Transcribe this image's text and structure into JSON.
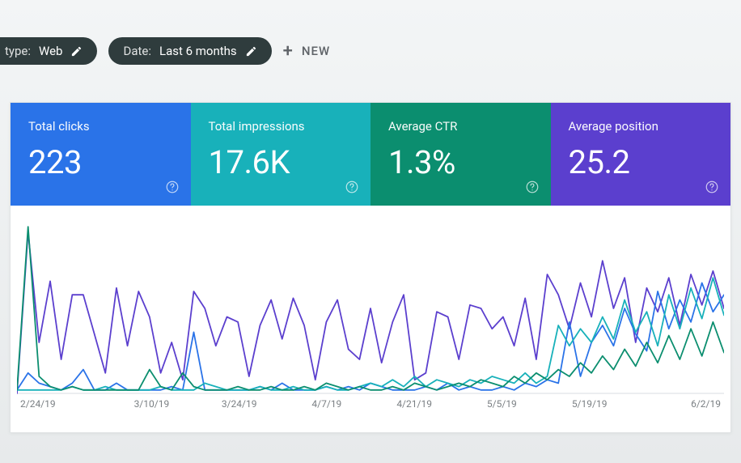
{
  "filters": {
    "search_type": {
      "label_key": "type:",
      "label_value": "Web"
    },
    "date": {
      "label_key": "Date:",
      "label_value": "Last 6 months"
    },
    "new_label": "NEW"
  },
  "metrics": {
    "clicks": {
      "label": "Total clicks",
      "value": "223",
      "help": "?"
    },
    "impressions": {
      "label": "Total impressions",
      "value": "17.6K",
      "help": "?"
    },
    "ctr": {
      "label": "Average CTR",
      "value": "1.3%",
      "help": "?"
    },
    "position": {
      "label": "Average position",
      "value": "25.2",
      "help": "?"
    }
  },
  "colors": {
    "clicks": "#2a73e8",
    "impressions": "#18b1ba",
    "ctr": "#0b8e6f",
    "position": "#5b3fce"
  },
  "chart_data": {
    "type": "line",
    "title": "",
    "xlabel": "",
    "ylabel": "",
    "x_ticks": [
      "2/24/19",
      "3/10/19",
      "3/24/19",
      "4/7/19",
      "4/21/19",
      "5/5/19",
      "5/19/19",
      "6/2/19"
    ],
    "ylim": [
      0,
      100
    ],
    "series": [
      {
        "name": "position",
        "color": "#5b3fce",
        "values": [
          0,
          95,
          30,
          66,
          20,
          58,
          58,
          35,
          12,
          62,
          28,
          60,
          45,
          12,
          30,
          8,
          60,
          50,
          28,
          45,
          42,
          10,
          40,
          55,
          32,
          56,
          40,
          8,
          42,
          55,
          26,
          20,
          50,
          18,
          42,
          58,
          8,
          12,
          48,
          45,
          20,
          52,
          50,
          38,
          45,
          28,
          56,
          20,
          70,
          58,
          38,
          65,
          45,
          78,
          50,
          68,
          30,
          62,
          48,
          68,
          40,
          70,
          52,
          72,
          50
        ]
      },
      {
        "name": "clicks",
        "color": "#2a73e8",
        "values": [
          2,
          12,
          6,
          4,
          2,
          6,
          14,
          2,
          2,
          6,
          2,
          2,
          2,
          2,
          4,
          2,
          36,
          2,
          2,
          2,
          2,
          2,
          4,
          2,
          6,
          2,
          2,
          2,
          4,
          2,
          4,
          2,
          6,
          4,
          2,
          2,
          2,
          4,
          2,
          6,
          2,
          4,
          2,
          2,
          4,
          2,
          6,
          4,
          8,
          6,
          42,
          10,
          30,
          40,
          28,
          50,
          35,
          25,
          60,
          38,
          55,
          42,
          65,
          48,
          58
        ]
      },
      {
        "name": "impressions",
        "color": "#18b1ba",
        "values": [
          2,
          2,
          2,
          2,
          2,
          4,
          2,
          2,
          4,
          2,
          2,
          2,
          2,
          4,
          2,
          2,
          2,
          6,
          4,
          2,
          2,
          2,
          4,
          2,
          2,
          4,
          2,
          2,
          4,
          2,
          2,
          4,
          6,
          4,
          8,
          4,
          10,
          4,
          8,
          6,
          4,
          8,
          6,
          10,
          8,
          6,
          12,
          6,
          10,
          40,
          28,
          38,
          30,
          45,
          32,
          55,
          36,
          48,
          28,
          58,
          38,
          62,
          44,
          68,
          46
        ]
      },
      {
        "name": "ctr",
        "color": "#0b8e6f",
        "values": [
          2,
          98,
          10,
          4,
          2,
          4,
          2,
          2,
          2,
          2,
          2,
          2,
          14,
          4,
          2,
          12,
          4,
          2,
          2,
          2,
          4,
          2,
          2,
          4,
          2,
          2,
          4,
          2,
          6,
          4,
          2,
          4,
          2,
          2,
          4,
          2,
          6,
          4,
          2,
          4,
          6,
          4,
          8,
          6,
          4,
          10,
          6,
          12,
          8,
          14,
          10,
          18,
          12,
          22,
          14,
          26,
          16,
          30,
          18,
          34,
          20,
          38,
          22,
          42,
          24
        ]
      }
    ]
  }
}
